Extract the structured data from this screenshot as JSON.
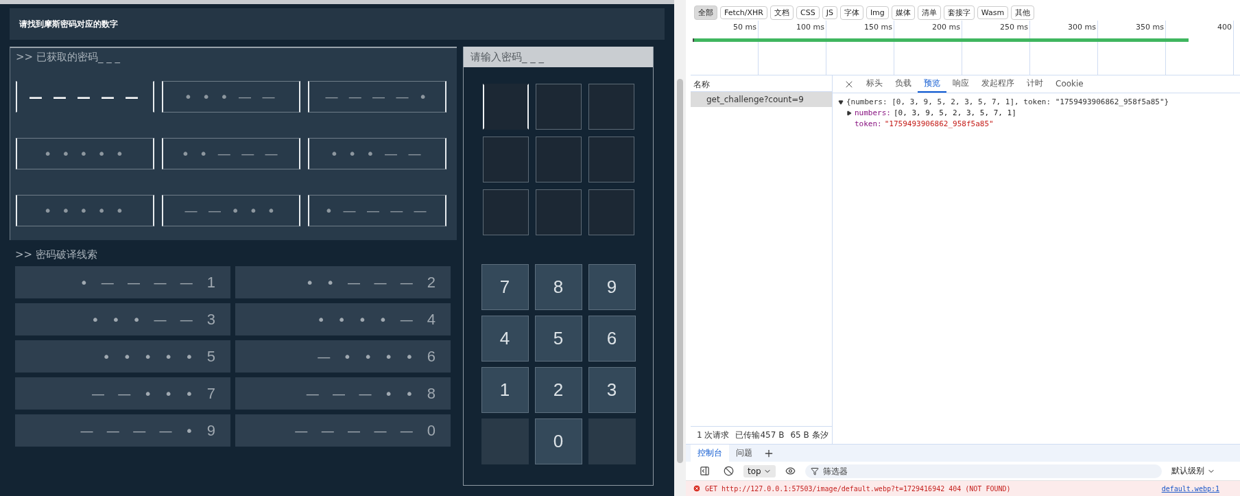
{
  "game": {
    "title": "请找到摩斯密码对应的数字",
    "obtained": {
      "heading": ">> 已获取的密码_ _ _",
      "codes": [
        {
          "morse": "— — — — —",
          "selected": true
        },
        {
          "morse": "• • • — —",
          "selected": false
        },
        {
          "morse": "— — — — •",
          "selected": false
        },
        {
          "morse": "• • • • •",
          "selected": false
        },
        {
          "morse": "• • — — —",
          "selected": false
        },
        {
          "morse": "• • • — —",
          "selected": false
        },
        {
          "morse": "• • • • •",
          "selected": false
        },
        {
          "morse": "— — • • •",
          "selected": false
        },
        {
          "morse": "• — — — —",
          "selected": false
        }
      ]
    },
    "clues": {
      "heading": ">> 密码破译线索",
      "items": [
        {
          "morse": "• — — — —",
          "digit": "1"
        },
        {
          "morse": "• • — — —",
          "digit": "2"
        },
        {
          "morse": "• • • — —",
          "digit": "3"
        },
        {
          "morse": "• • • • —",
          "digit": "4"
        },
        {
          "morse": "• • • • •",
          "digit": "5"
        },
        {
          "morse": "— • • • •",
          "digit": "6"
        },
        {
          "morse": "— — • • •",
          "digit": "7"
        },
        {
          "morse": "— — — • •",
          "digit": "8"
        },
        {
          "morse": "— — — — •",
          "digit": "9"
        },
        {
          "morse": "— — — — —",
          "digit": "0"
        }
      ]
    },
    "input": {
      "heading": "请输入密码_ _ _",
      "slots": [
        {
          "selected": true
        },
        {
          "selected": false
        },
        {
          "selected": false
        },
        {
          "selected": false
        },
        {
          "selected": false
        },
        {
          "selected": false
        },
        {
          "selected": false
        },
        {
          "selected": false
        },
        {
          "selected": false
        }
      ],
      "keys": [
        {
          "kind": "key",
          "label": "7"
        },
        {
          "kind": "key",
          "label": "8"
        },
        {
          "kind": "key",
          "label": "9"
        },
        {
          "kind": "key",
          "label": "4"
        },
        {
          "kind": "key",
          "label": "5"
        },
        {
          "kind": "key",
          "label": "6"
        },
        {
          "kind": "key",
          "label": "1"
        },
        {
          "kind": "key",
          "label": "2"
        },
        {
          "kind": "key",
          "label": "3"
        },
        {
          "kind": "blank"
        },
        {
          "kind": "key",
          "label": "0"
        },
        {
          "kind": "blank"
        }
      ]
    }
  },
  "devtools": {
    "filters": [
      {
        "label": "全部",
        "selected": true
      },
      {
        "label": "Fetch/XHR",
        "selected": false
      },
      {
        "label": "文档",
        "selected": false
      },
      {
        "label": "CSS",
        "selected": false
      },
      {
        "label": "JS",
        "selected": false
      },
      {
        "label": "字体",
        "selected": false
      },
      {
        "label": "Img",
        "selected": false
      },
      {
        "label": "媒体",
        "selected": false
      },
      {
        "label": "清单",
        "selected": false
      },
      {
        "label": "套接字",
        "selected": false
      },
      {
        "label": "Wasm",
        "selected": false
      },
      {
        "label": "其他",
        "selected": false
      }
    ],
    "timeline_ticks": [
      "50 ms",
      "100 ms",
      "150 ms",
      "200 ms",
      "250 ms",
      "300 ms",
      "350 ms",
      "400"
    ],
    "requests": {
      "header": "名称",
      "items": [
        {
          "label": "get_challenge?count=9",
          "selected": true
        }
      ]
    },
    "detail_tabs": [
      {
        "label": "标头",
        "selected": false
      },
      {
        "label": "负载",
        "selected": false
      },
      {
        "label": "预览",
        "selected": true
      },
      {
        "label": "响应",
        "selected": false
      },
      {
        "label": "发起程序",
        "selected": false
      },
      {
        "label": "计时",
        "selected": false
      },
      {
        "label": "Cookie",
        "selected": false
      }
    ],
    "preview": {
      "summary": "{numbers: [0, 3, 9, 5, 2, 3, 5, 7, 1], token: \"1759493906862_958f5a85\"}",
      "fields": [
        {
          "key": "numbers:",
          "value": "[0, 3, 9, 5, 2, 3, 5, 7, 1]",
          "kind": "array"
        },
        {
          "key": "token:",
          "value": "\"1759493906862_958f5a85\"",
          "kind": "string"
        }
      ]
    },
    "status": [
      "1 次请求",
      "已传输457 B",
      "65 B 条汐"
    ],
    "console_tabs": [
      {
        "label": "控制台",
        "selected": true
      },
      {
        "label": "问题",
        "selected": false
      }
    ],
    "console_toolbar": {
      "context": "top",
      "filter_placeholder": "筛选器",
      "level": "默认级别"
    },
    "error": {
      "message": "GET http://127.0.0.1:57503/image/default.webp?t=1729416942 404 (NOT FOUND)",
      "source": "default.webp:1"
    }
  }
}
